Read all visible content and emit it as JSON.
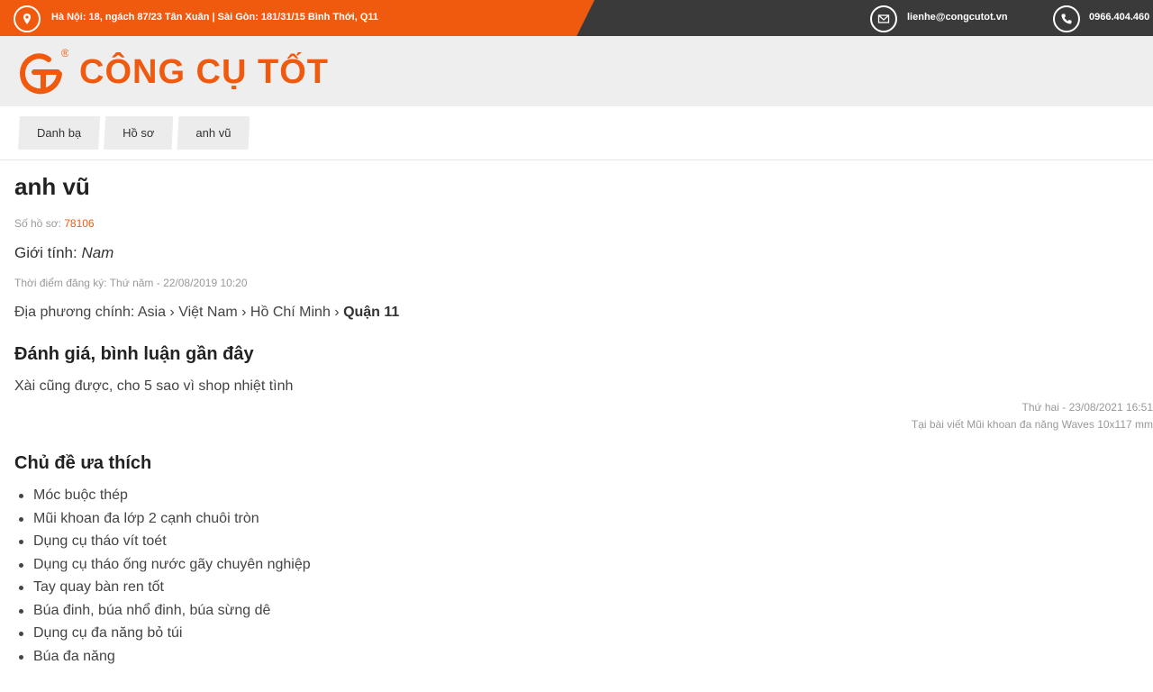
{
  "topbar": {
    "address": "Hà Nội: 18, ngách 87/23 Tân Xuân | Sài Gòn: 181/31/15 Bình Thới, Q11",
    "email": "lienhe@congcutot.vn",
    "phone": "0966.404.460"
  },
  "logo": {
    "text": "CÔNG CỤ TỐT"
  },
  "breadcrumb": [
    "Danh bạ",
    "Hồ sơ",
    "anh vũ"
  ],
  "profile": {
    "name": "anh vũ",
    "id_label": "Số hồ sơ: ",
    "id_value": "78106",
    "gender_label": "Giới tính: ",
    "gender_value": "Nam",
    "registered": "Thời điểm đăng ký: Thứ năm - 22/08/2019 10:20",
    "location_label": "Địa phương chính: ",
    "location_path": "Asia › Việt Nam › Hồ Chí Minh › ",
    "location_last": "Quận 11"
  },
  "reviews": {
    "title": "Đánh giá, bình luận gần đây",
    "items": [
      {
        "text": "Xài cũng được, cho 5 sao vì shop nhiệt tình",
        "date": "Thứ hai - 23/08/2021 16:51",
        "article": "Tại bài viết Mũi khoan đa năng Waves 10x117 mm"
      }
    ]
  },
  "favorites": {
    "title": "Chủ đề ưa thích",
    "items": [
      "Móc buộc thép",
      "Mũi khoan đa lớp 2 cạnh chuôi tròn",
      "Dụng cụ tháo vít toét",
      "Dụng cụ tháo ống nước gãy chuyên nghiệp",
      "Tay quay bàn ren tốt",
      "Búa đinh, búa nhổ đinh, búa sừng dê",
      "Dụng cụ đa năng bỏ túi",
      "Búa đa năng"
    ]
  },
  "colors": {
    "accent": "#f05a0e",
    "dark": "#3a3a3a"
  }
}
